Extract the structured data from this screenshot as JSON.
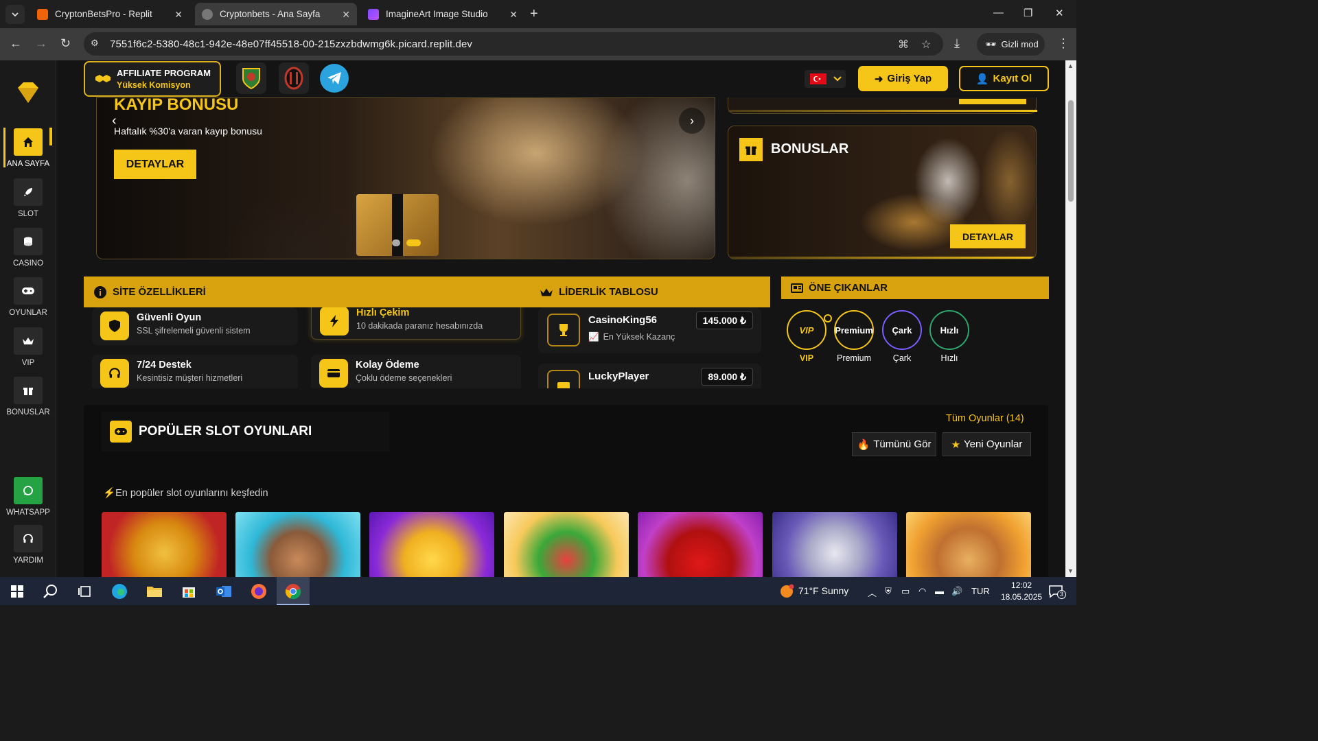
{
  "browser": {
    "tabs": [
      {
        "title": "CryptonBetsPro - Replit",
        "active": false
      },
      {
        "title": "Cryptonbets - Ana Sayfa",
        "active": true
      },
      {
        "title": "ImagineArt Image Studio",
        "active": false
      }
    ],
    "url": "7551f6c2-5380-48c1-942e-48e07ff45518-00-215zxzbdwmg6k.picard.replit.dev",
    "incognito_label": "Gizli mod"
  },
  "sidebar": {
    "items": [
      {
        "label": "ANA SAYFA",
        "icon": "home-icon",
        "active": true
      },
      {
        "label": "SLOT",
        "icon": "rocket-icon"
      },
      {
        "label": "CASINO",
        "icon": "coins-icon"
      },
      {
        "label": "OYUNLAR",
        "icon": "gamepad-icon"
      },
      {
        "label": "VIP",
        "icon": "crown-icon"
      },
      {
        "label": "BONUSLAR",
        "icon": "gift-icon"
      }
    ],
    "bottom": [
      {
        "label": "WHATSAPP",
        "icon": "whatsapp-icon"
      },
      {
        "label": "YARDIM",
        "icon": "headset-icon"
      }
    ]
  },
  "header": {
    "affiliate_title": "AFFILIATE PROGRAM",
    "affiliate_sub": "Yüksek Komisyon",
    "login": "Giriş Yap",
    "register": "Kayıt Ol"
  },
  "hero": {
    "title": "KAYIP BONUSU",
    "subtitle": "Haftalık %30'a varan kayıp bonusu",
    "cta": "DETAYLAR"
  },
  "bonus_card": {
    "title": "BONUSLAR",
    "cta": "DETAYLAR"
  },
  "features": {
    "title": "SİTE ÖZELLİKLERİ",
    "items": [
      {
        "title": "Güvenli Oyun",
        "desc": "SSL şifrelemeli güvenli sistem"
      },
      {
        "title": "Hızlı Çekim",
        "desc": "10 dakikada paranız hesabınızda"
      },
      {
        "title": "7/24 Destek",
        "desc": "Kesintisiz müşteri hizmetleri"
      },
      {
        "title": "Kolay Ödeme",
        "desc": "Çoklu ödeme seçenekleri"
      }
    ]
  },
  "leaderboard": {
    "title": "LİDERLİK TABLOSU",
    "entries": [
      {
        "name": "CasinoKing56",
        "amount": "145.000 ₺",
        "sub": "En Yüksek Kazanç"
      },
      {
        "name": "LuckyPlayer",
        "amount": "89.000 ₺"
      }
    ]
  },
  "featured": {
    "title": "ÖNE ÇIKANLAR",
    "items": [
      {
        "ring": "VIP",
        "label": "VIP",
        "color": "#f5c518"
      },
      {
        "ring": "Premium",
        "label": "Premium",
        "color": "#f5c518"
      },
      {
        "ring": "Çark",
        "label": "Çark",
        "color": "#7b5cff"
      },
      {
        "ring": "Hızlı",
        "label": "Hızlı",
        "color": "#2ea66b"
      }
    ]
  },
  "slots": {
    "title": "POPÜLER SLOT OYUNLARI",
    "all_games": "Tüm Oyunlar (14)",
    "see_all": "Tümünü Gör",
    "new_games": "Yeni Oyunlar",
    "tagline": "En popüler slot oyunlarını keşfedin"
  },
  "taskbar": {
    "weather": "71°F  Sunny",
    "lang": "TUR",
    "time": "12:02",
    "date": "18.05.2025",
    "notif_count": "3"
  },
  "colors": {
    "accent": "#f5c518",
    "panel": "#d8a30f",
    "background": "#141414"
  }
}
